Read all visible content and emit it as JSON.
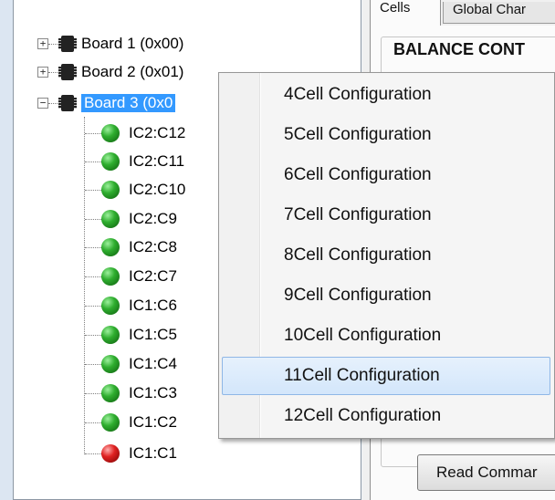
{
  "tabs": [
    {
      "label": "Cells"
    },
    {
      "label": "Global Char"
    }
  ],
  "group_title": "BALANCE CONT",
  "read_button_label": "Read Commar",
  "tree": {
    "boards": [
      {
        "label": "Board 1 (0x00)",
        "expander": "+"
      },
      {
        "label": "Board 2 (0x01)",
        "expander": "+"
      },
      {
        "label": "Board 3 (0x0",
        "expander": "−"
      }
    ],
    "cells": [
      {
        "label": "IC2:C12",
        "status": "green"
      },
      {
        "label": "IC2:C11",
        "status": "green"
      },
      {
        "label": "IC2:C10",
        "status": "green"
      },
      {
        "label": "IC2:C9",
        "status": "green"
      },
      {
        "label": "IC2:C8",
        "status": "green"
      },
      {
        "label": "IC2:C7",
        "status": "green"
      },
      {
        "label": "IC1:C6",
        "status": "green"
      },
      {
        "label": "IC1:C5",
        "status": "green"
      },
      {
        "label": "IC1:C4",
        "status": "green"
      },
      {
        "label": "IC1:C3",
        "status": "green"
      },
      {
        "label": "IC1:C2",
        "status": "green"
      },
      {
        "label": "IC1:C1",
        "status": "red"
      }
    ]
  },
  "context_menu": {
    "items": [
      {
        "label": "4Cell Configuration"
      },
      {
        "label": "5Cell Configuration"
      },
      {
        "label": "6Cell Configuration"
      },
      {
        "label": "7Cell Configuration"
      },
      {
        "label": "8Cell Configuration"
      },
      {
        "label": "9Cell Configuration"
      },
      {
        "label": "10Cell Configuration"
      },
      {
        "label": "11Cell Configuration",
        "highlighted": true
      },
      {
        "label": "12Cell Configuration"
      }
    ]
  },
  "colors": {
    "selection": "#3399ff",
    "led_ok": "#2fae2f",
    "led_fault": "#e02222",
    "menu_highlight_border": "#8fb7e6"
  }
}
